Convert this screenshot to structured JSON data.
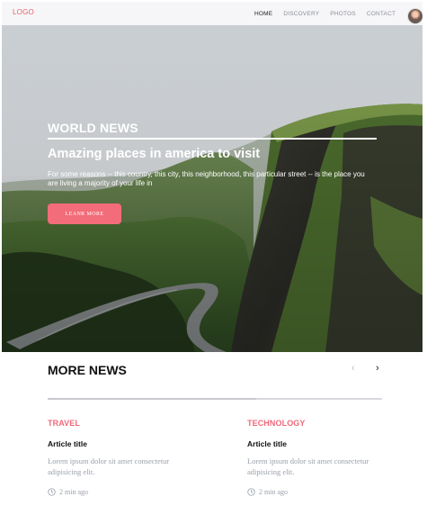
{
  "header": {
    "logo": "LOGO",
    "nav": [
      "HOME",
      "DISCOVERY",
      "PHOTOS",
      "CONTACT"
    ]
  },
  "hero": {
    "kicker": "WORLD NEWS",
    "title": "Amazing places in america to visit",
    "text": "For some reasons -- this country, this city, this neighborhood, this particular street -- is the place you are living a majority of your life in",
    "button": "LEANR MORE"
  },
  "more_news": {
    "title": "MORE NEWS",
    "articles": [
      {
        "category": "TRAVEL",
        "title": "Article title",
        "excerpt": "Lorem ipsum dolor sit amet consectetur adipisicing elit.",
        "time": "2 min ago"
      },
      {
        "category": "TECHNOLOGY",
        "title": "Article title",
        "excerpt": "Lorem ipsum dolor sit amet consectetur adipisicing elit.",
        "time": "2 min ago"
      }
    ]
  },
  "colors": {
    "accent": "#f26c79",
    "category": "#f0697a",
    "muted_text": "#9aa0ab"
  },
  "icons": [
    "avatar",
    "arrow-left-icon",
    "arrow-right-icon",
    "clock-icon"
  ]
}
